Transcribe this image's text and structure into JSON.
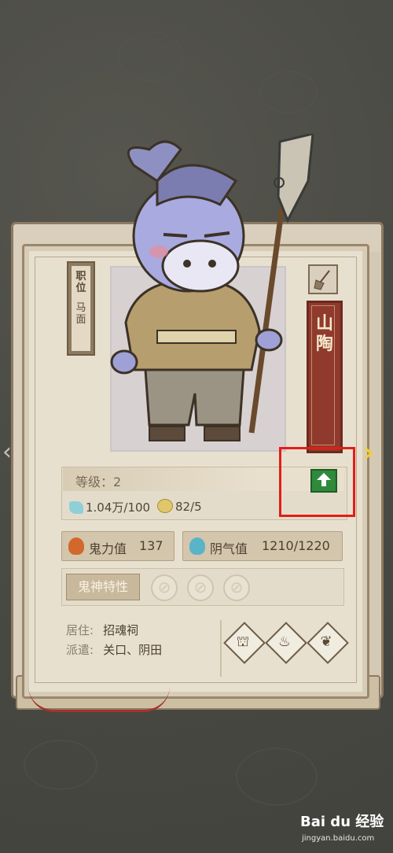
{
  "character": {
    "position_label": "职位",
    "position_value": "马面",
    "name": "山陶"
  },
  "level": {
    "label": "等级：2",
    "upgrade_icon": "up-arrow-icon"
  },
  "resources": {
    "jade": "1.04万/100",
    "coin": "82/5"
  },
  "stats": {
    "ghost_power_label": "鬼力值",
    "ghost_power_value": "137",
    "yin_qi_label": "阴气值",
    "yin_qi_value": "1210/1220"
  },
  "traits": {
    "button_label": "鬼神特性",
    "slot_glyph": "⊘"
  },
  "info": {
    "residence_label": "居住:",
    "residence_value": "招魂祠",
    "dispatch_label": "派遣:",
    "dispatch_value": "关口、阴田"
  },
  "navigation": {
    "prev": "‹",
    "next": "›"
  },
  "watermark": {
    "brand": "Bai du 经验",
    "url": "jingyan.baidu.com"
  },
  "colors": {
    "name_banner": "#8f3a2c",
    "upgrade": "#2f8a3c",
    "highlight": "#e11e18"
  }
}
